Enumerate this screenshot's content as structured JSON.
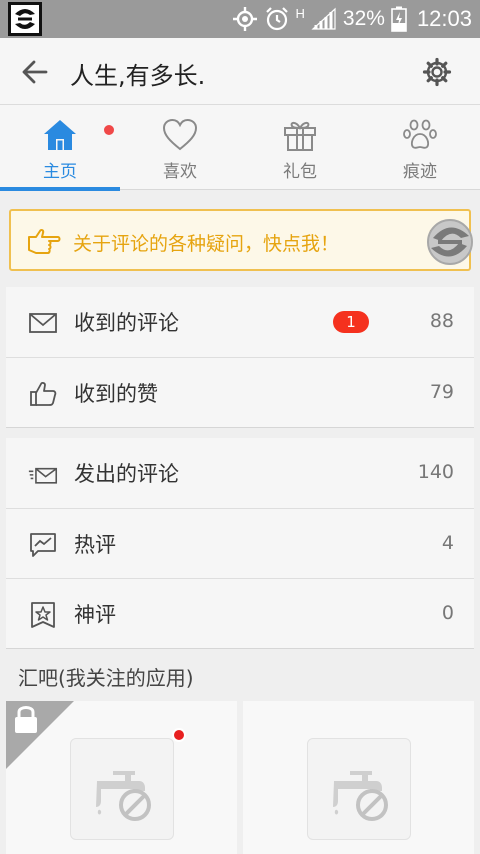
{
  "status_bar": {
    "network": "H",
    "battery": "32%",
    "time": "12:03"
  },
  "header": {
    "title": "人生,有多长."
  },
  "tabs": [
    {
      "label": "主页",
      "icon": "home-icon",
      "active": true,
      "has_dot": true
    },
    {
      "label": "喜欢",
      "icon": "heart-icon",
      "active": false
    },
    {
      "label": "礼包",
      "icon": "gift-icon",
      "active": false
    },
    {
      "label": "痕迹",
      "icon": "paw-icon",
      "active": false
    }
  ],
  "notice": {
    "text": "关于评论的各种疑问，快点我！"
  },
  "received": [
    {
      "label": "收到的评论",
      "icon": "mail-icon",
      "badge": "1",
      "count": "88"
    },
    {
      "label": "收到的赞",
      "icon": "thumbs-up-icon",
      "count": "79"
    }
  ],
  "activity": [
    {
      "label": "发出的评论",
      "icon": "sent-mail-icon",
      "count": "140"
    },
    {
      "label": "热评",
      "icon": "trend-chat-icon",
      "count": "4"
    },
    {
      "label": "神评",
      "icon": "star-badge-icon",
      "count": "0"
    }
  ],
  "section": {
    "title": "汇吧(我关注的应用)"
  },
  "colors": {
    "accent": "#2a8ae0",
    "notice_text": "#e6a410",
    "notice_border": "#f0c050",
    "badge": "#f5311e"
  }
}
